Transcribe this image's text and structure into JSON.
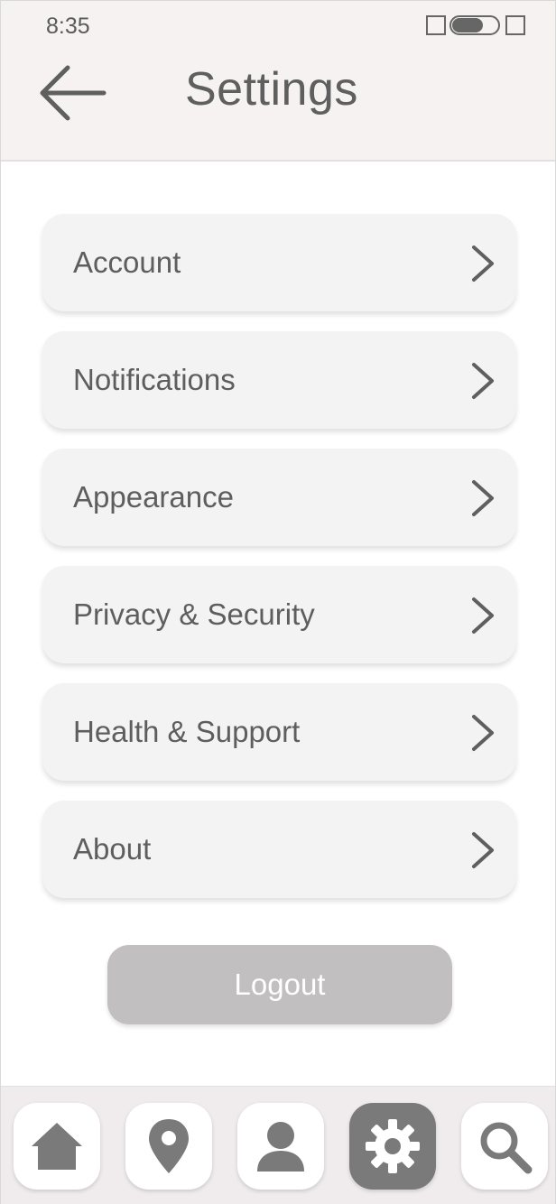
{
  "status_bar": {
    "time": "8:35",
    "icons": [
      "square-icon",
      "toggle-icon",
      "square-icon"
    ]
  },
  "header": {
    "title": "Settings",
    "back_icon": "arrow-left-icon"
  },
  "settings": {
    "items": [
      {
        "label": "Account",
        "icon": "chevron-right-icon"
      },
      {
        "label": "Notifications",
        "icon": "chevron-right-icon"
      },
      {
        "label": "Appearance",
        "icon": "chevron-right-icon"
      },
      {
        "label": "Privacy & Security",
        "icon": "chevron-right-icon"
      },
      {
        "label": "Health & Support",
        "icon": "chevron-right-icon"
      },
      {
        "label": "About",
        "icon": "chevron-right-icon"
      }
    ]
  },
  "logout": {
    "label": "Logout"
  },
  "bottom_nav": {
    "items": [
      {
        "icon": "home-icon",
        "active": false
      },
      {
        "icon": "location-pin-icon",
        "active": false
      },
      {
        "icon": "user-icon",
        "active": false
      },
      {
        "icon": "gear-icon",
        "active": true
      },
      {
        "icon": "search-icon",
        "active": false
      }
    ]
  },
  "colors": {
    "header_bg": "#f5f2f1",
    "item_bg": "#f3f3f3",
    "text": "#5f5f5f",
    "logout_bg": "#c1bfbf",
    "active_nav_bg": "#7a7a7a"
  }
}
